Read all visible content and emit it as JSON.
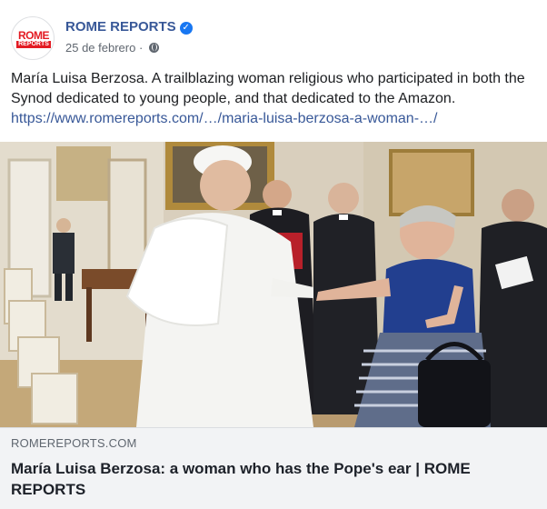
{
  "post": {
    "page_name": "ROME REPORTS",
    "verified_icon": "verified-check-icon",
    "date": "25 de febrero",
    "separator": " · ",
    "privacy_icon": "globe-icon",
    "avatar": {
      "logo_line1": "ROME",
      "logo_line2": "REPORTS",
      "brand_color": "#e31b23"
    },
    "text": "María Luisa Berzosa. A trailblazing woman religious who participated in both the Synod dedicated to young people, and that dedicated to the Amazon.",
    "link_text": "https://www.romereports.com/…/maria-luisa-berzosa-a-woman-…/"
  },
  "link_preview": {
    "domain": "ROMEREPORTS.COM",
    "title": "María Luisa Berzosa: a woman who has the Pope's ear | ROME REPORTS"
  },
  "colors": {
    "link": "#385898",
    "meta_text": "#606770",
    "verified": "#1877f2",
    "preview_bg": "#f2f3f5"
  }
}
